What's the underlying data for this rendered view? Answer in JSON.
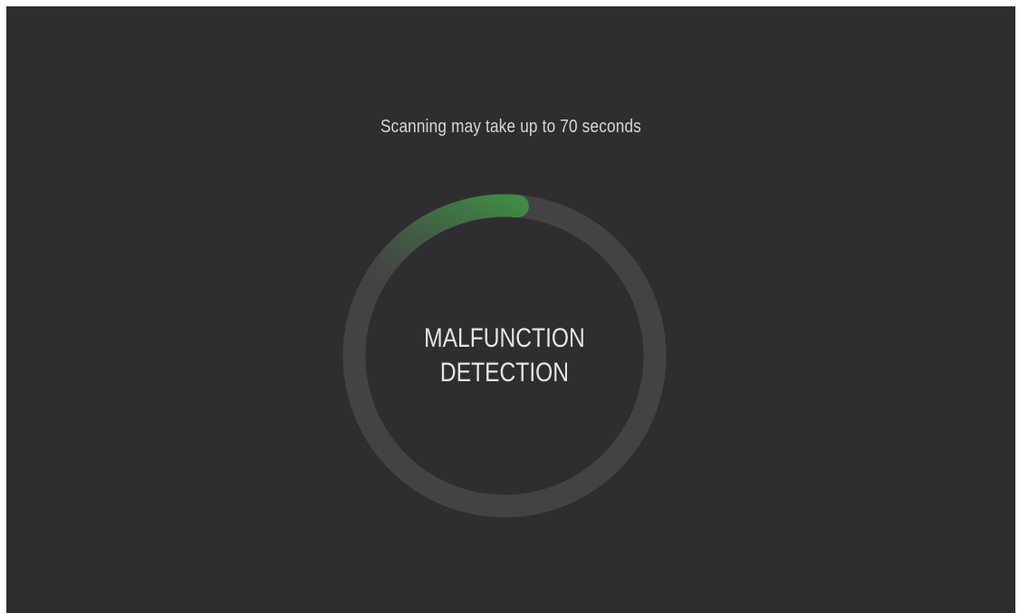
{
  "scan": {
    "hint": "Scanning may take up to 70 seconds",
    "title_line1": "MALFUNCTION",
    "title_line2": "DETECTION",
    "progress_fraction": 0.18
  },
  "colors": {
    "background": "#302d30",
    "track": "#444245",
    "progress": "#3f8a45",
    "text": "#e6e4e6"
  }
}
